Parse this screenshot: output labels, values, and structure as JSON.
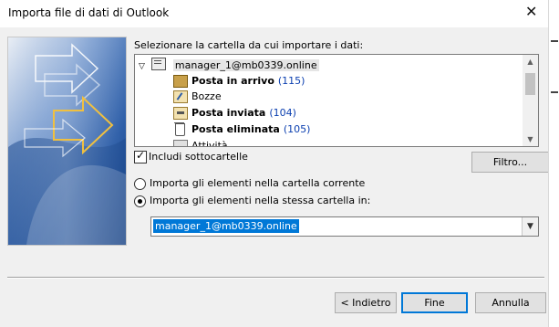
{
  "window": {
    "title": "Importa file di dati di Outlook",
    "close_icon": "close-icon"
  },
  "prompt": "Selezionare la cartella da cui importare i dati:",
  "tree": {
    "root": {
      "expander": "▽",
      "label": "manager_1@mb0339.online",
      "icon": "mailbox-icon"
    },
    "items": [
      {
        "label": "Posta in arrivo",
        "count": "(115)",
        "bold": true,
        "icon": "inbox-icon"
      },
      {
        "label": "Bozze",
        "count": "",
        "bold": false,
        "icon": "drafts-icon"
      },
      {
        "label": "Posta inviata",
        "count": "(104)",
        "bold": true,
        "icon": "sent-icon"
      },
      {
        "label": "Posta eliminata",
        "count": "(105)",
        "bold": true,
        "icon": "trash-icon"
      },
      {
        "label": "Attività",
        "count": "",
        "bold": false,
        "icon": "tasks-icon"
      }
    ]
  },
  "include_subfolders": {
    "label": "Includi sottocartelle",
    "checked": true
  },
  "filter_button": "Filtro...",
  "radios": [
    {
      "label": "Importa gli elementi nella cartella corrente",
      "selected": false
    },
    {
      "label": "Importa gli elementi nella stessa cartella in:",
      "selected": true
    }
  ],
  "target_select": {
    "value": "manager_1@mb0339.online"
  },
  "buttons": {
    "back": "< Indietro",
    "finish": "Fine",
    "cancel": "Annulla"
  },
  "colors": {
    "accent": "#0078d7",
    "count_blue": "#0b3fb0"
  }
}
